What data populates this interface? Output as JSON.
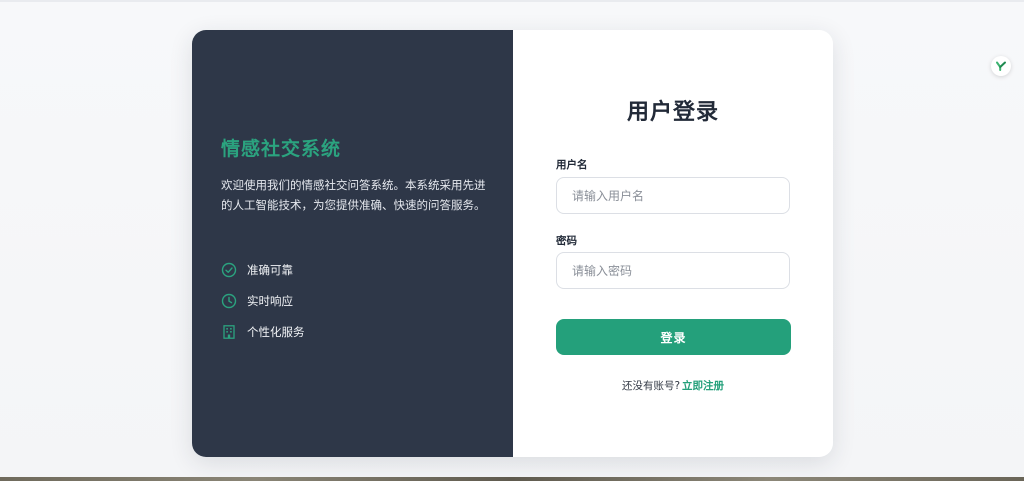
{
  "brand": {
    "title": "情感社交系统",
    "description": "欢迎使用我们的情感社交问答系统。本系统采用先进的人工智能技术，为您提供准确、快速的问答服务。"
  },
  "features": [
    {
      "icon": "check-circle-icon",
      "label": "准确可靠"
    },
    {
      "icon": "clock-icon",
      "label": "实时响应"
    },
    {
      "icon": "building-icon",
      "label": "个性化服务"
    }
  ],
  "login": {
    "title": "用户登录",
    "username_label": "用户名",
    "username_placeholder": "请输入用户名",
    "username_value": "",
    "password_label": "密码",
    "password_placeholder": "请输入密码",
    "password_value": "",
    "submit_label": "登录",
    "register_prompt": "还没有账号?",
    "register_link": "立即注册"
  },
  "colors": {
    "accent": "#24a07b",
    "panel_dark": "#2e3748",
    "title_text": "#222a38"
  }
}
